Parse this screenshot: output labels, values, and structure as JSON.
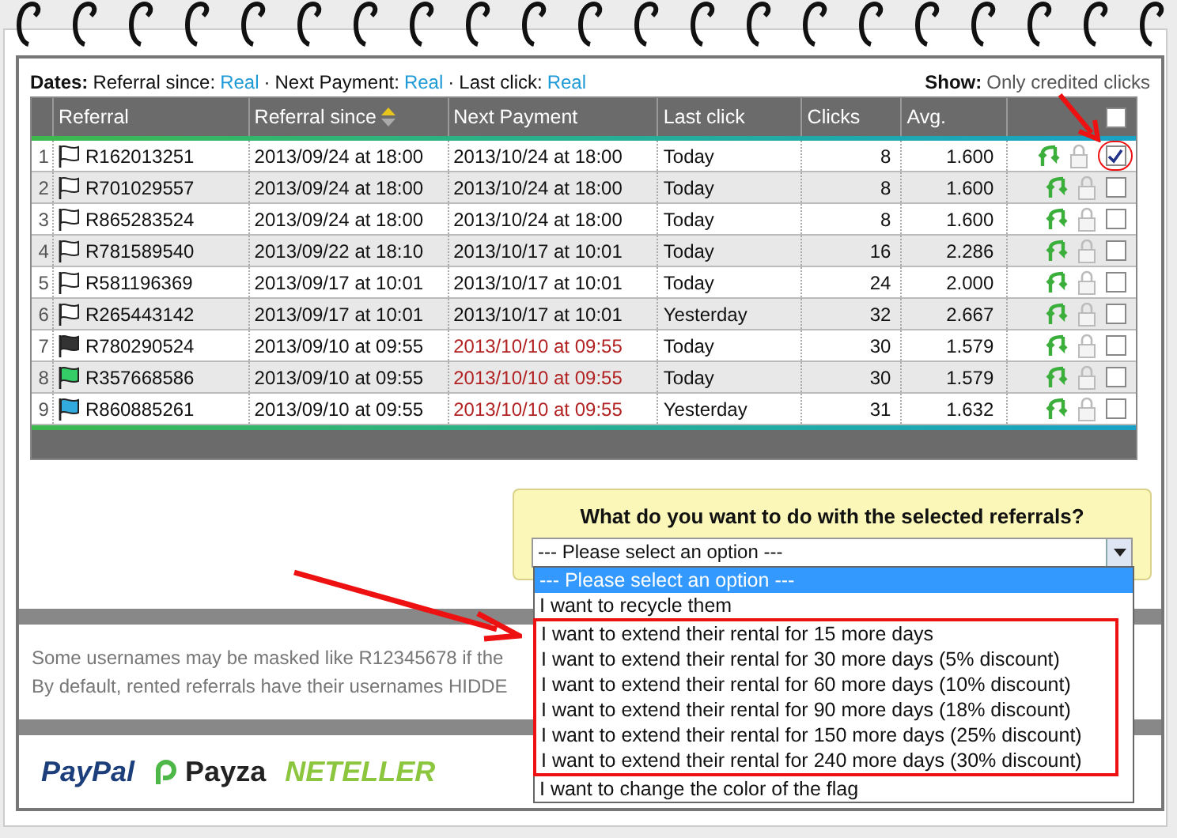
{
  "dates": {
    "label": "Dates:",
    "separator": "·",
    "items": [
      {
        "label": "Referral since:",
        "value": "Real"
      },
      {
        "label": "Next Payment:",
        "value": "Real"
      },
      {
        "label": "Last click:",
        "value": "Real"
      }
    ]
  },
  "show": {
    "label": "Show:",
    "value": "Only credited clicks"
  },
  "table": {
    "columns": [
      {
        "label": "Referral",
        "sorted": false
      },
      {
        "label": "Referral since",
        "sorted": true
      },
      {
        "label": "Next Payment",
        "sorted": false
      },
      {
        "label": "Last click",
        "sorted": false
      },
      {
        "label": "Clicks",
        "sorted": false
      },
      {
        "label": "Avg.",
        "sorted": false
      }
    ],
    "select_all": {
      "checked": false
    },
    "rows": [
      {
        "number": "1",
        "color": "#ffffff",
        "referral": "R162013251",
        "since": "2013/09/24 at 18:00",
        "next_payment": "2013/10/24 at 18:00",
        "overdue": false,
        "last_click": "Today",
        "clicks": "8",
        "avg": "1.600",
        "checked": true,
        "circled": true
      },
      {
        "number": "2",
        "color": "#ffffff",
        "referral": "R701029557",
        "since": "2013/09/24 at 18:00",
        "next_payment": "2013/10/24 at 18:00",
        "overdue": false,
        "last_click": "Today",
        "clicks": "8",
        "avg": "1.600",
        "checked": false
      },
      {
        "number": "3",
        "color": "#ffffff",
        "referral": "R865283524",
        "since": "2013/09/24 at 18:00",
        "next_payment": "2013/10/24 at 18:00",
        "overdue": false,
        "last_click": "Today",
        "clicks": "8",
        "avg": "1.600",
        "checked": false
      },
      {
        "number": "4",
        "color": "#ffffff",
        "referral": "R781589540",
        "since": "2013/09/22 at 18:10",
        "next_payment": "2013/10/17 at 10:01",
        "overdue": false,
        "last_click": "Today",
        "clicks": "16",
        "avg": "2.286",
        "checked": false
      },
      {
        "number": "5",
        "color": "#ffffff",
        "referral": "R581196369",
        "since": "2013/09/17 at 10:01",
        "next_payment": "2013/10/17 at 10:01",
        "overdue": false,
        "last_click": "Today",
        "clicks": "24",
        "avg": "2.000",
        "checked": false
      },
      {
        "number": "6",
        "color": "#ffffff",
        "referral": "R265443142",
        "since": "2013/09/17 at 10:01",
        "next_payment": "2013/10/17 at 10:01",
        "overdue": false,
        "last_click": "Yesterday",
        "clicks": "32",
        "avg": "2.667",
        "checked": false
      },
      {
        "number": "7",
        "color": "#333333",
        "referral": "R780290524",
        "since": "2013/09/10 at 09:55",
        "next_payment": "2013/10/10 at 09:55",
        "overdue": true,
        "last_click": "Today",
        "clicks": "30",
        "avg": "1.579",
        "checked": false
      },
      {
        "number": "8",
        "color": "#33cc66",
        "referral": "R357668586",
        "since": "2013/09/10 at 09:55",
        "next_payment": "2013/10/10 at 09:55",
        "overdue": true,
        "last_click": "Today",
        "clicks": "30",
        "avg": "1.579",
        "checked": false
      },
      {
        "number": "9",
        "color": "#33aadd",
        "referral": "R860885261",
        "since": "2013/09/10 at 09:55",
        "next_payment": "2013/10/10 at 09:55",
        "overdue": true,
        "last_click": "Yesterday",
        "clicks": "31",
        "avg": "1.632",
        "checked": false
      }
    ]
  },
  "action": {
    "question": "What do you want to do with the selected referrals?",
    "select_value": "--- Please select an option ---",
    "options": [
      {
        "label": "--- Please select an option ---",
        "selected": true
      },
      {
        "label": "I want to recycle them",
        "selected": false
      },
      {
        "label": "I want to extend their rental for 15 more days",
        "selected": false,
        "highlighted": true
      },
      {
        "label": "I want to extend their rental for 30 more days (5% discount)",
        "selected": false,
        "highlighted": true
      },
      {
        "label": "I want to extend their rental for 60 more days (10% discount)",
        "selected": false,
        "highlighted": true
      },
      {
        "label": "I want to extend their rental for 90 more days (18% discount)",
        "selected": false,
        "highlighted": true
      },
      {
        "label": "I want to extend their rental for 150 more days (25% discount)",
        "selected": false,
        "highlighted": true
      },
      {
        "label": "I want to extend their rental for 240 more days (30% discount)",
        "selected": false,
        "highlighted": true
      },
      {
        "label": "I want to change the color of the flag",
        "selected": false
      }
    ]
  },
  "notes": [
    "Some usernames may be masked like R12345678 if the",
    "By default, rented referrals have their usernames HIDDE"
  ],
  "payment_logos": [
    "PayPal",
    "Payza",
    "NETELLER"
  ]
}
